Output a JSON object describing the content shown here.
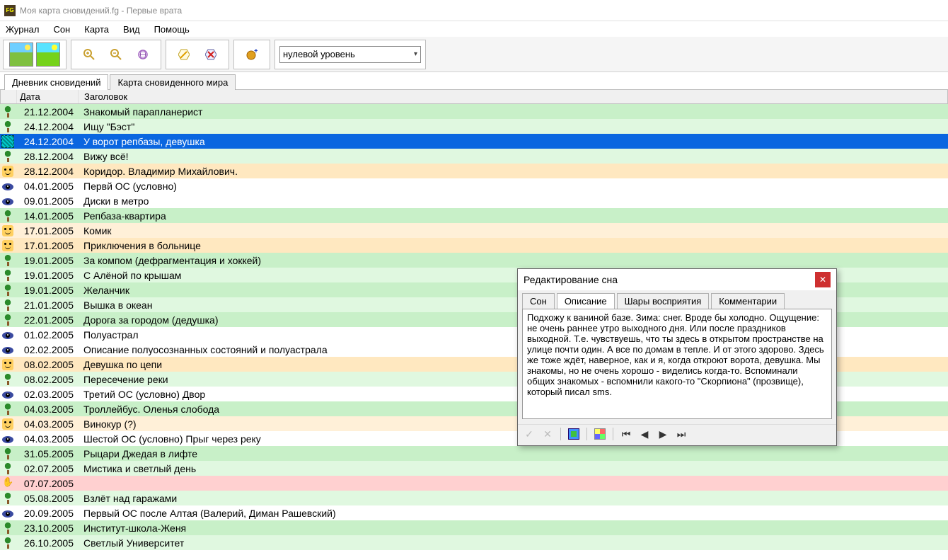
{
  "window": {
    "title": "Моя карта сновидений.fg - Первые врата"
  },
  "menu": [
    "Журнал",
    "Сон",
    "Карта",
    "Вид",
    "Помощь"
  ],
  "toolbar": {
    "level_select": "нулевой уровень"
  },
  "tabs": {
    "diary": "Дневник сновидений",
    "map": "Карта сновиденного мира"
  },
  "headers": {
    "date": "Дата",
    "title": "Заголовок"
  },
  "rows": [
    {
      "icon": "tree",
      "date": "21.12.2004",
      "title": "Знакомый парапланерист",
      "bg": "green"
    },
    {
      "icon": "tree",
      "date": "24.12.2004",
      "title": "Ищу \"Бэст\"",
      "bg": "lightgreen"
    },
    {
      "icon": "sel",
      "date": "24.12.2004",
      "title": "У ворот репбазы, девушка",
      "bg": "selected"
    },
    {
      "icon": "tree",
      "date": "28.12.2004",
      "title": "Вижу всё!",
      "bg": "lightgreen"
    },
    {
      "icon": "face",
      "date": "28.12.2004",
      "title": "Коридор. Владимир Михайлович.",
      "bg": "orange"
    },
    {
      "icon": "eye",
      "date": "04.01.2005",
      "title": "Первй ОС (условно)",
      "bg": "white"
    },
    {
      "icon": "eye",
      "date": "09.01.2005",
      "title": "Диски в метро",
      "bg": "white"
    },
    {
      "icon": "tree",
      "date": "14.01.2005",
      "title": "Репбаза-квартира",
      "bg": "green"
    },
    {
      "icon": "face",
      "date": "17.01.2005",
      "title": "Комик",
      "bg": "lightorange"
    },
    {
      "icon": "face",
      "date": "17.01.2005",
      "title": "Приключения в больнице",
      "bg": "orange"
    },
    {
      "icon": "tree",
      "date": "19.01.2005",
      "title": "За компом (дефрагментация и хоккей)",
      "bg": "green"
    },
    {
      "icon": "tree",
      "date": "19.01.2005",
      "title": "С Алёной по крышам",
      "bg": "lightgreen"
    },
    {
      "icon": "tree",
      "date": "19.01.2005",
      "title": "Желанчик",
      "bg": "green"
    },
    {
      "icon": "tree",
      "date": "21.01.2005",
      "title": "Вышка в океан",
      "bg": "lightgreen"
    },
    {
      "icon": "tree",
      "date": "22.01.2005",
      "title": "Дорога за городом (дедушка)",
      "bg": "green"
    },
    {
      "icon": "eye",
      "date": "01.02.2005",
      "title": "Полуастрал",
      "bg": "white"
    },
    {
      "icon": "eye",
      "date": "02.02.2005",
      "title": "Описание полуосознанных состояний и полуастрала",
      "bg": "white"
    },
    {
      "icon": "face",
      "date": "08.02.2005",
      "title": "Девушка по цепи",
      "bg": "orange"
    },
    {
      "icon": "tree",
      "date": "08.02.2005",
      "title": "Пересечение реки",
      "bg": "lightgreen"
    },
    {
      "icon": "eye",
      "date": "02.03.2005",
      "title": "Третий ОС (условно) Двор",
      "bg": "white"
    },
    {
      "icon": "tree",
      "date": "04.03.2005",
      "title": "Троллейбус. Оленья слобода",
      "bg": "green"
    },
    {
      "icon": "face",
      "date": "04.03.2005",
      "title": "Винокур (?)",
      "bg": "lightorange"
    },
    {
      "icon": "eye",
      "date": "04.03.2005",
      "title": "Шестой ОС (условно) Прыг через реку",
      "bg": "white"
    },
    {
      "icon": "tree",
      "date": "31.05.2005",
      "title": "Рыцари Джедая в лифте",
      "bg": "green"
    },
    {
      "icon": "tree",
      "date": "02.07.2005",
      "title": "Мистика и светлый день",
      "bg": "lightgreen"
    },
    {
      "icon": "hand",
      "date": "07.07.2005",
      "title": "",
      "bg": "pink"
    },
    {
      "icon": "tree",
      "date": "05.08.2005",
      "title": "Взлёт над гаражами",
      "bg": "lightgreen"
    },
    {
      "icon": "eye",
      "date": "20.09.2005",
      "title": "Первый ОС после Алтая (Валерий, Диман Рашевский)",
      "bg": "white"
    },
    {
      "icon": "tree",
      "date": "23.10.2005",
      "title": "Институт-школа-Женя",
      "bg": "green"
    },
    {
      "icon": "tree",
      "date": "26.10.2005",
      "title": "Светлый Университет",
      "bg": "lightgreen"
    }
  ],
  "dialog": {
    "title": "Редактирование сна",
    "tabs": [
      "Сон",
      "Описание",
      "Шары восприятия",
      "Комментарии"
    ],
    "active_tab": 1,
    "text": "Подхожу к ваниной базе. Зима: снег. Вроде бы холодно. Ощущение: не очень раннее утро выходного дня. Или после праздников выходной. Т.е. чувствуешь, что ты здесь в открытом пространстве на улице почти один. А все по домам в тепле. И от этого здорово. Здесь же тоже ждёт, наверное, как и я, когда откроют ворота, девушка. Мы знакомы, но не очень хорошо - виделись когда-то. Вспоминали общих знакомых - вспомнили какого-то \"Скорпиона\" (прозвище), который писал sms."
  }
}
